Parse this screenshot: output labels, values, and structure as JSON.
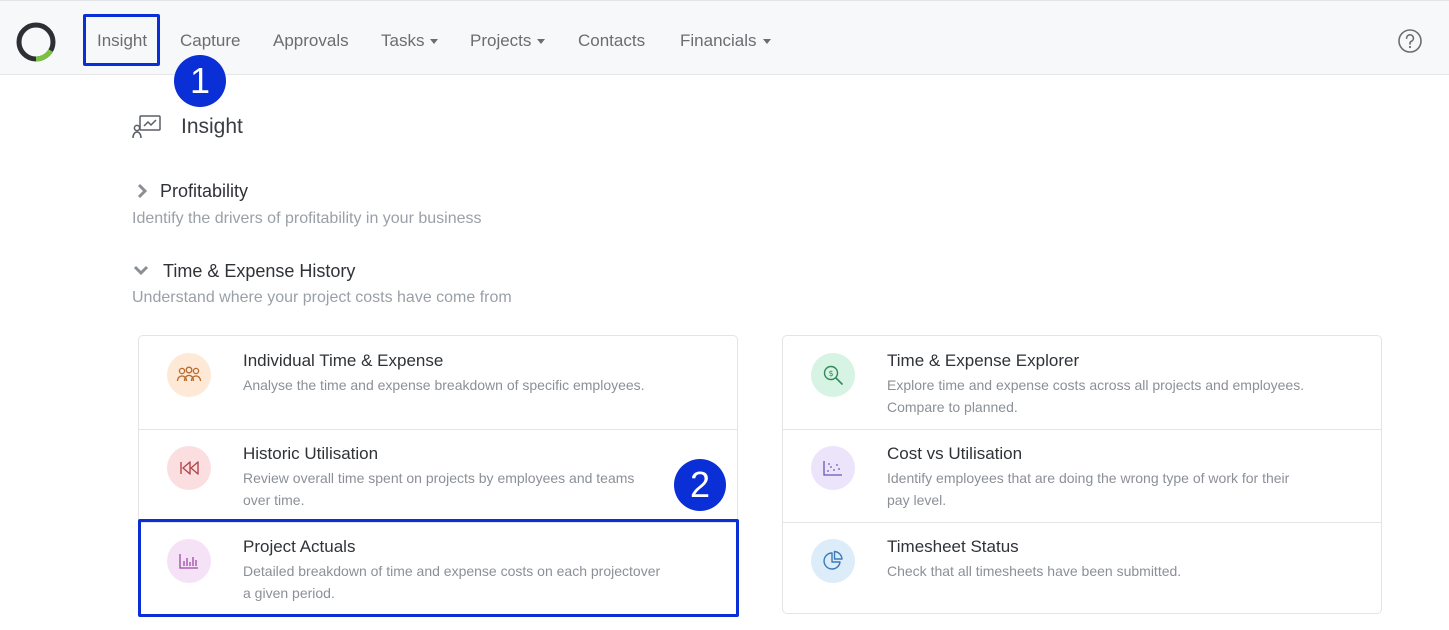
{
  "nav": {
    "items": [
      {
        "label": "Insight",
        "dropdown": false
      },
      {
        "label": "Capture",
        "dropdown": false
      },
      {
        "label": "Approvals",
        "dropdown": false
      },
      {
        "label": "Tasks",
        "dropdown": true
      },
      {
        "label": "Projects",
        "dropdown": true
      },
      {
        "label": "Contacts",
        "dropdown": false
      },
      {
        "label": "Financials",
        "dropdown": true
      }
    ]
  },
  "badges": [
    "1",
    "2"
  ],
  "page": {
    "title": "Insight"
  },
  "sections": [
    {
      "title": "Profitability",
      "subtitle": "Identify the drivers of profitability in your business",
      "expanded": false
    },
    {
      "title": "Time & Expense History",
      "subtitle": "Understand where your project costs have come from",
      "expanded": true
    }
  ],
  "cards_left": [
    {
      "title": "Individual Time & Expense",
      "desc": "Analyse the time and expense breakdown of specific employees.",
      "icon": "users-icon",
      "bg": "#fde9d6",
      "fg": "#b86a2e"
    },
    {
      "title": "Historic Utilisation",
      "desc": "Review overall time spent on projects by employees and teams over time.",
      "icon": "rewind-icon",
      "bg": "#fbdfe0",
      "fg": "#b3474d"
    },
    {
      "title": "Project Actuals",
      "desc": "Detailed breakdown of time and expense costs on each projectover a given period.",
      "icon": "bar-chart-icon",
      "bg": "#f6e2f7",
      "fg": "#9b4aa5"
    }
  ],
  "cards_right": [
    {
      "title": "Time & Expense Explorer",
      "desc": "Explore time and expense costs across all projects and employees. Compare to planned.",
      "icon": "money-search-icon",
      "bg": "#d6f3e4",
      "fg": "#2f8a5a"
    },
    {
      "title": "Cost vs Utilisation",
      "desc": "Identify employees that are doing the wrong type of work for their pay level.",
      "icon": "scatter-icon",
      "bg": "#ebe4fb",
      "fg": "#6b55b8"
    },
    {
      "title": "Timesheet Status",
      "desc": "Check that all timesheets have been submitted.",
      "icon": "pie-chart-icon",
      "bg": "#dcecf9",
      "fg": "#3b7ab8"
    }
  ],
  "colors": {
    "accent": "#0a2fd6",
    "logo_green": "#7ac143",
    "logo_dark": "#2c2f33"
  }
}
